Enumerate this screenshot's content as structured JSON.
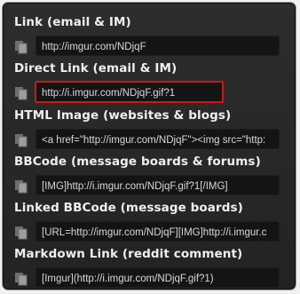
{
  "sections": [
    {
      "title": "Link (email & IM)",
      "value": "http://imgur.com/NDjqF"
    },
    {
      "title": "Direct Link (email & IM)",
      "value": "http://i.imgur.com/NDjqF.gif?1"
    },
    {
      "title": "HTML Image (websites & blogs)",
      "value": "<a href=\"http://imgur.com/NDjqF\"><img src=\"http:"
    },
    {
      "title": "BBCode (message boards & forums)",
      "value": "[IMG]http://i.imgur.com/NDjqF.gif?1[/IMG]"
    },
    {
      "title": "Linked BBCode (message boards)",
      "value": "[URL=http://imgur.com/NDjqF][IMG]http://i.imgur.c"
    },
    {
      "title": "Markdown Link (reddit comment)",
      "value": "[Imgur](http://i.imgur.com/NDjqF.gif?1)"
    }
  ],
  "icon": "copy-icon",
  "colors": {
    "highlight": "#c81a1a",
    "panel": "#262626",
    "field": "#141414"
  }
}
